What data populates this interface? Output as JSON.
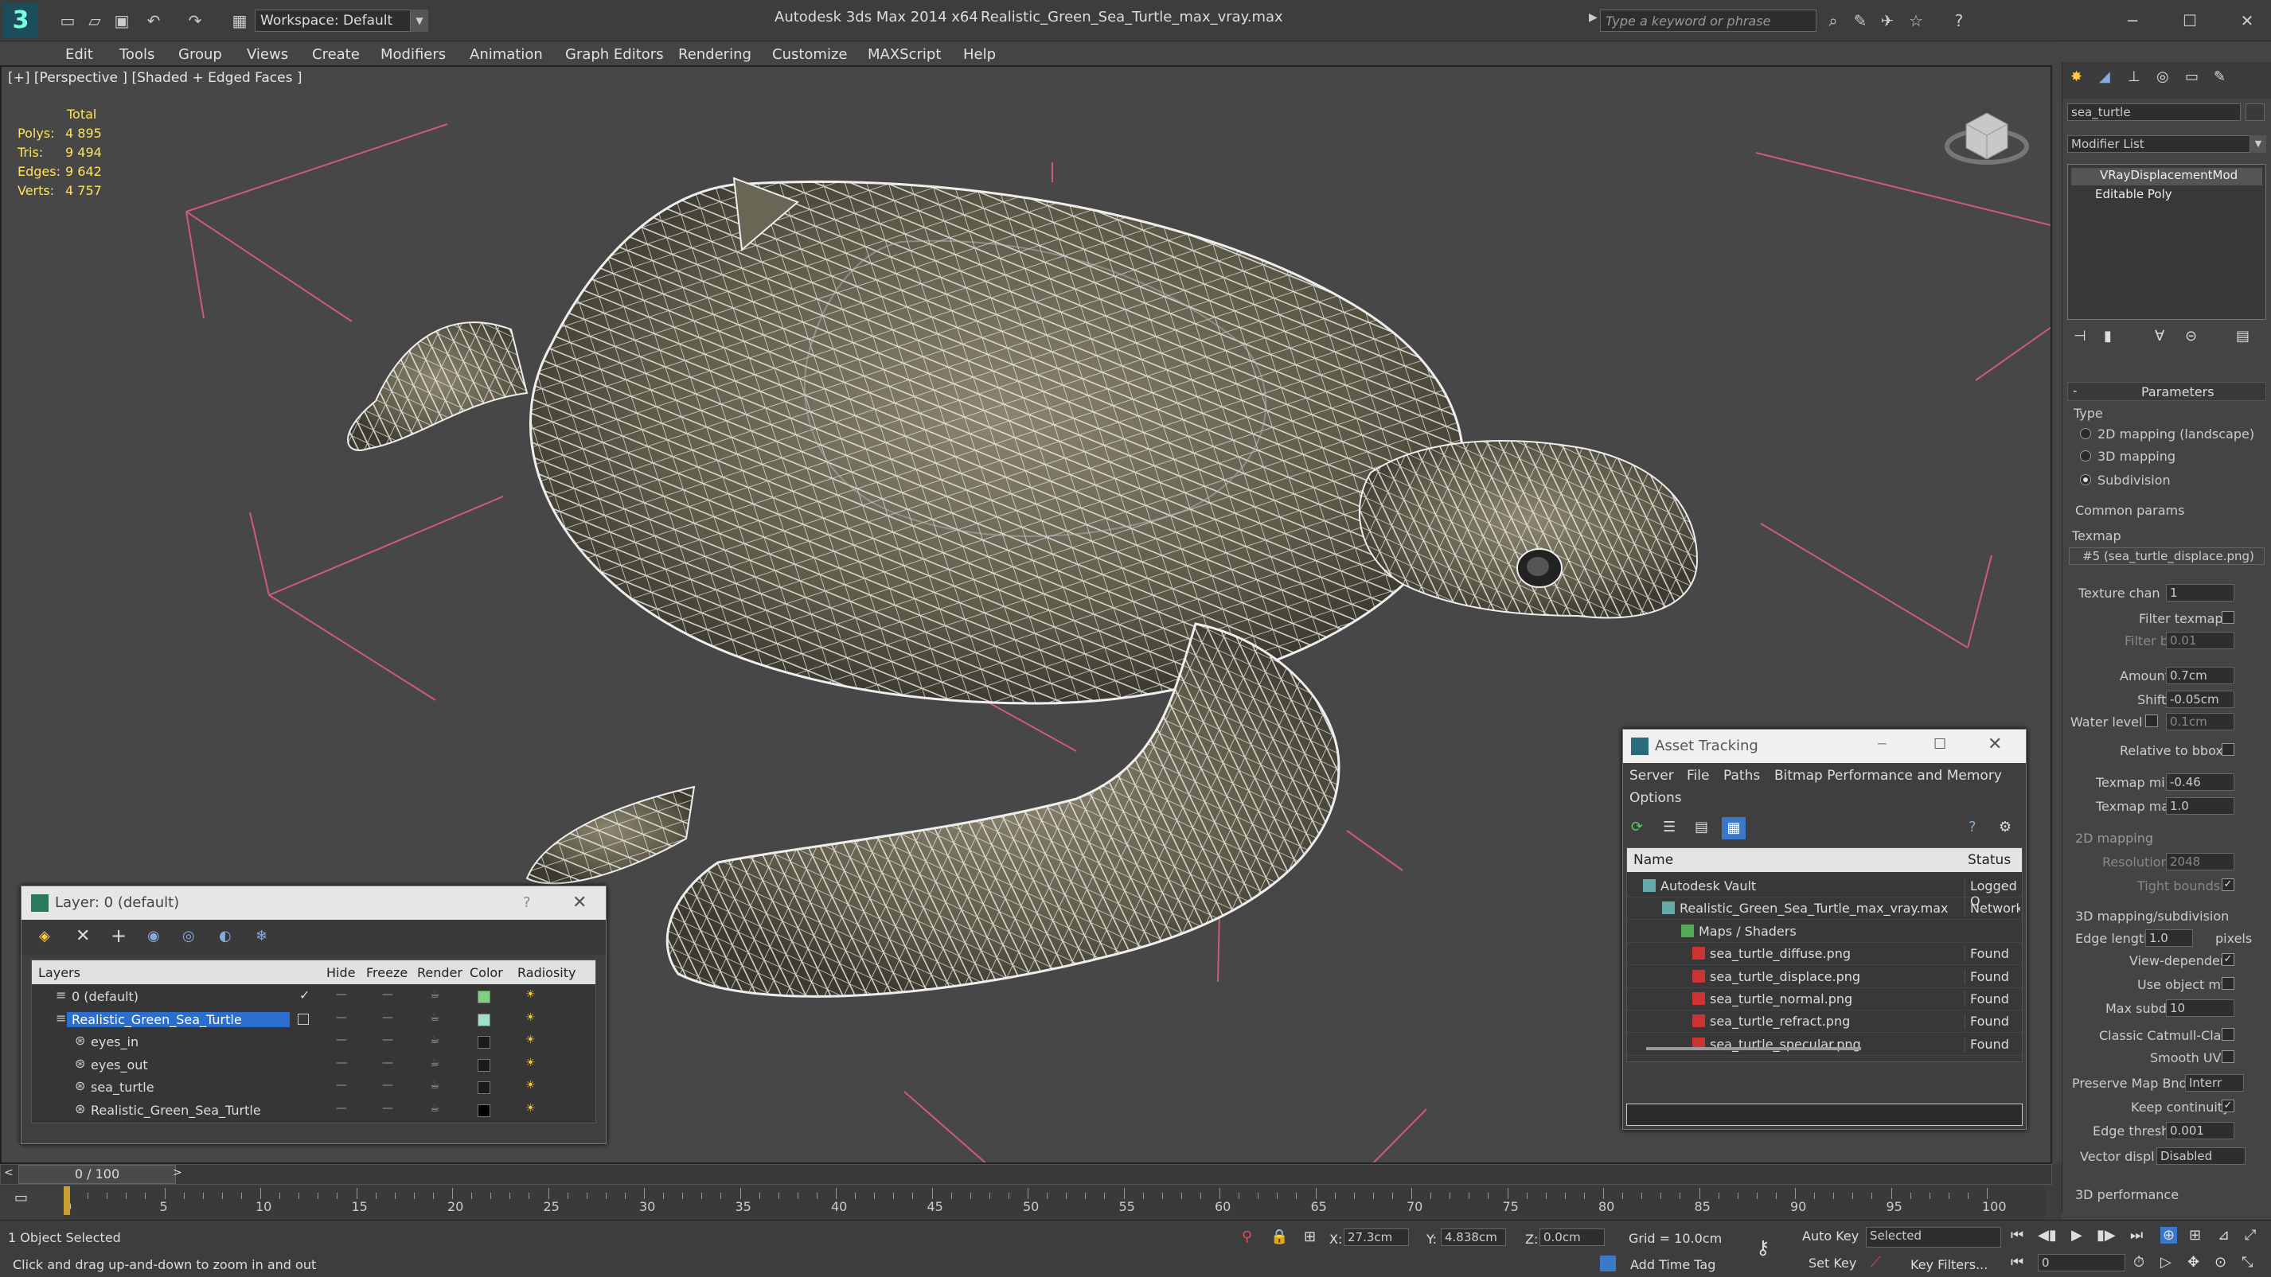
{
  "titlebar": {
    "app": "Autodesk 3ds Max  2014 x64",
    "file": "Realistic_Green_Sea_Turtle_max_vray.max",
    "workspace": "Workspace: Default",
    "search_placeholder": "Type a keyword or phrase"
  },
  "menu": [
    "Edit",
    "Tools",
    "Group",
    "Views",
    "Create",
    "Modifiers",
    "Animation",
    "Graph Editors",
    "Rendering",
    "Customize",
    "MAXScript",
    "Help"
  ],
  "viewport": {
    "label": "[+] [Perspective ] [Shaded + Edged Faces ]",
    "stats": {
      "total": "Total",
      "polys_label": "Polys:",
      "polys": "4 895",
      "tris_label": "Tris:",
      "tris": "9 494",
      "edges_label": "Edges:",
      "edges": "9 642",
      "verts_label": "Verts:",
      "verts": "4 757"
    }
  },
  "layer_window": {
    "title": "Layer: 0 (default)",
    "help": "?",
    "columns": [
      "Layers",
      "Hide",
      "Freeze",
      "Render",
      "Color",
      "Radiosity"
    ],
    "rows": [
      {
        "name": "0 (default)",
        "color": "#7fcf7f"
      },
      {
        "name": "Realistic_Green_Sea_Turtle",
        "color": "#9fdfcf"
      },
      {
        "name": "eyes_in",
        "color": "#1a1a1a"
      },
      {
        "name": "eyes_out",
        "color": "#1a1a1a"
      },
      {
        "name": "sea_turtle",
        "color": "#1a1a1a"
      },
      {
        "name": "Realistic_Green_Sea_Turtle",
        "color": "#000000"
      }
    ]
  },
  "asset_window": {
    "title": "Asset Tracking",
    "menu": [
      "Server",
      "File",
      "Paths",
      "Bitmap Performance and Memory"
    ],
    "menu2": "Options",
    "col_name": "Name",
    "col_status": "Status",
    "rows": [
      {
        "name": "Autodesk Vault",
        "status": "Logged O"
      },
      {
        "name": "Realistic_Green_Sea_Turtle_max_vray.max",
        "status": "Network"
      },
      {
        "name": "Maps / Shaders",
        "status": ""
      },
      {
        "name": "sea_turtle_diffuse.png",
        "status": "Found"
      },
      {
        "name": "sea_turtle_displace.png",
        "status": "Found"
      },
      {
        "name": "sea_turtle_normal.png",
        "status": "Found"
      },
      {
        "name": "sea_turtle_refract.png",
        "status": "Found"
      },
      {
        "name": "sea_turtle_specular.png",
        "status": "Found"
      }
    ]
  },
  "cmdpanel": {
    "object_name": "sea_turtle",
    "modifier_list": "Modifier List",
    "stack": [
      "VRayDisplacementMod",
      "Editable Poly"
    ],
    "parameters": "Parameters",
    "type": "Type",
    "type_opts": [
      "2D mapping (landscape)",
      "3D mapping",
      "Subdivision"
    ],
    "common": "Common params",
    "texmap": "Texmap",
    "texmap_val": "#5 (sea_turtle_displace.png)",
    "texture_chan": "Texture chan",
    "texture_chan_val": "1",
    "filter_texmap": "Filter texmap",
    "filter_blur": "Filter blur",
    "filter_blur_val": "0.01",
    "amount": "Amount",
    "amount_val": "0.7cm",
    "shift": "Shift",
    "shift_val": "-0.05cm",
    "water_level": "Water level",
    "water_level_val": "0.1cm",
    "relative_bbox": "Relative to bbox",
    "texmap_min": "Texmap min",
    "texmap_min_val": "-0.46",
    "texmap_max": "Texmap max",
    "texmap_max_val": "1.0",
    "map2d": "2D mapping",
    "resolution": "Resolution",
    "resolution_val": "2048",
    "tight_bounds": "Tight bounds",
    "sub3d": "3D mapping/subdivision",
    "edge_length": "Edge length",
    "edge_length_val": "1.0",
    "pixels": "pixels",
    "view_dependent": "View-dependent",
    "use_object_mtl": "Use object mtl",
    "max_subdivs": "Max subdivs",
    "max_subdivs_val": "10",
    "catmull": "Classic Catmull-Clark",
    "smooth_uvs": "Smooth UVs",
    "preserve": "Preserve Map Bnd",
    "preserve_val": "Interr",
    "keep_cont": "Keep continuity",
    "edge_thresh": "Edge thresh",
    "edge_thresh_val": "0.001",
    "vector": "Vector displ",
    "vector_val": "Disabled",
    "perf": "3D performance"
  },
  "timeline": {
    "frame": "0 / 100",
    "ticks": [
      "0",
      "5",
      "10",
      "15",
      "20",
      "25",
      "30",
      "35",
      "40",
      "45",
      "50",
      "55",
      "60",
      "65",
      "70",
      "75",
      "80",
      "85",
      "90",
      "95",
      "100"
    ]
  },
  "status": {
    "selected": "1 Object Selected",
    "hint": "Click and drag up-and-down to zoom in and out",
    "x": "X:",
    "x_val": "27.3cm",
    "y": "Y:",
    "y_val": "4.838cm",
    "z": "Z:",
    "z_val": "0.0cm",
    "grid": "Grid = 10.0cm",
    "auto_key": "Auto Key",
    "set_key": "Set Key",
    "sel_mode": "Selected",
    "key_filters": "Key Filters...",
    "add_time_tag": "Add Time Tag",
    "frame": "0"
  }
}
